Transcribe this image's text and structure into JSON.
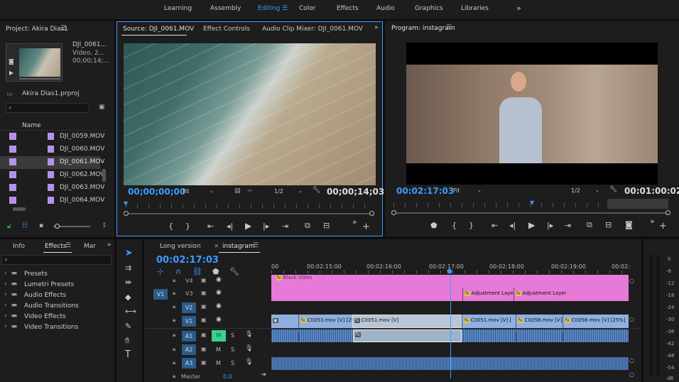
{
  "workspaces": {
    "items": [
      "Learning",
      "Assembly",
      "Editing",
      "Color",
      "Effects",
      "Audio",
      "Graphics",
      "Libraries"
    ],
    "active": "Editing",
    "more": "»"
  },
  "project": {
    "title": "Project: Akira Dias1",
    "clip_name": "DJI_0061...",
    "clip_type": "Video, 2...",
    "clip_time": "00;00;14;...",
    "file": "Akira Dias1.prproj",
    "col_name": "Name",
    "files": [
      "DJI_0059.MOV",
      "DJI_0060.MOV",
      "DJI_0061.MOV",
      "DJI_0062.MOV",
      "DJI_0063.MOV",
      "DJI_0064.MOV"
    ],
    "selected_index": 2
  },
  "source": {
    "tabs": [
      "Source: DJI_0061.MOV",
      "Effect Controls",
      "Audio Clip Mixer: DJI_0061.MOV"
    ],
    "timecode": "00;00;00;00",
    "fit": "Fit",
    "res": "1/2",
    "duration": "00;00;14;03"
  },
  "program": {
    "title": "Program: instagram",
    "timecode": "00:02:17:03",
    "fit": "Fit",
    "res": "1/2",
    "duration": "00:01:00:02"
  },
  "effects": {
    "tabs": [
      "Info",
      "Effects",
      "Mar"
    ],
    "folders": [
      "Presets",
      "Lumetri Presets",
      "Audio Effects",
      "Audio Transitions",
      "Video Effects",
      "Video Transitions"
    ]
  },
  "timeline": {
    "tabs": [
      "Long version",
      "instagram"
    ],
    "timecode": "00:02:17:03",
    "ruler": [
      "00",
      "00:02:15:00",
      "00:02:16:00",
      "00:02:17:00",
      "00:02:18:00",
      "00:02:19:00",
      "00:02:"
    ],
    "tracks": [
      "V4",
      "V3",
      "V2",
      "V1",
      "A1",
      "A2",
      "A3"
    ],
    "source_patch": "V1",
    "master_label": "Master",
    "master_value": "0.0",
    "m_label": "M",
    "s_label": "S",
    "clips": {
      "black": "Black Video",
      "adj1": "Adjustment Layer",
      "adj2": "Adjustment Layer",
      "c0053": "C0053.mov [V] [25",
      "c0051a": "C0051.mov [V]",
      "c0051b": "C0051.mov [V] [",
      "c0058a": "C0058.mov [V]",
      "c0058b": "C0058.mov [V] [25%]"
    }
  },
  "meter": {
    "labels": [
      "0",
      "-6",
      "-12",
      "-18",
      "-24",
      "-30",
      "-36",
      "-42",
      "-48",
      "-54",
      "dB"
    ]
  },
  "colors": {
    "accent": "#3b9bff",
    "adjustment": "#e77ad7",
    "video_clip": "#8fb0e0",
    "audio_clip": "#5a8ac8",
    "selected_row": "#3a3a3a"
  }
}
